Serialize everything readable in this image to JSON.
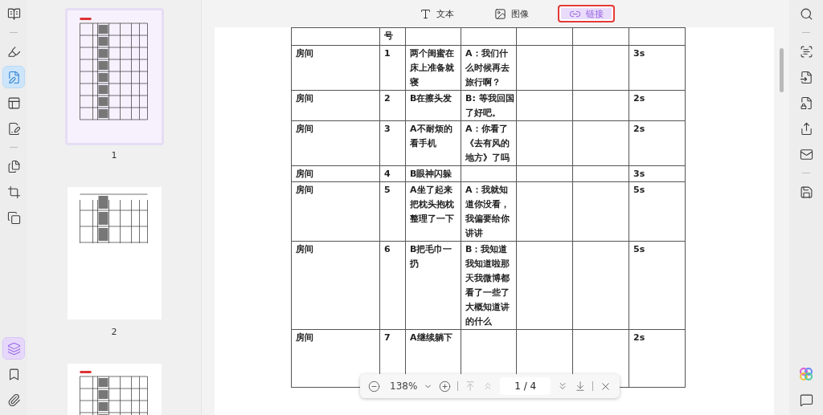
{
  "left_toolbar": {
    "top_tools": [
      {
        "kind": "reader",
        "selected": false
      },
      {
        "kind": "divider"
      },
      {
        "kind": "highlight",
        "selected": false
      },
      {
        "kind": "edit",
        "selected": true
      },
      {
        "kind": "form",
        "selected": false
      },
      {
        "kind": "sign",
        "selected": false
      },
      {
        "kind": "divider"
      },
      {
        "kind": "pages",
        "selected": false
      },
      {
        "kind": "crop",
        "selected": false
      },
      {
        "kind": "copy",
        "selected": false
      }
    ],
    "bottom_tools": [
      {
        "kind": "layers",
        "selected": true
      },
      {
        "kind": "bookmark",
        "selected": false
      },
      {
        "kind": "attachment",
        "selected": false
      }
    ]
  },
  "thumbnails": [
    {
      "label": "1",
      "selected": true
    },
    {
      "label": "2",
      "selected": false
    },
    {
      "selected": false
    }
  ],
  "tabs": [
    {
      "kind": "text",
      "label": "文本",
      "selected": false
    },
    {
      "kind": "image",
      "label": "图像",
      "selected": false
    },
    {
      "kind": "link",
      "label": "链接",
      "selected": true
    }
  ],
  "table": {
    "header_fragment": "号",
    "rows": [
      {
        "scene": "房间",
        "no": "1",
        "action": "两个闺蜜在床上准备就寝",
        "dialogue": "A：我们什么时候再去旅行啊？",
        "duration": "3s"
      },
      {
        "scene": "房间",
        "no": "2",
        "action": "B在擦头发",
        "dialogue": "B: 等我回国了好吧。",
        "duration": "2s"
      },
      {
        "scene": "房间",
        "no": "3",
        "action": "A不耐烦的看手机",
        "dialogue": "A：你看了《去有风的地方》了吗",
        "duration": "2s"
      },
      {
        "scene": "房间",
        "no": "4",
        "action": "B眼神闪躲",
        "duration": "3s"
      },
      {
        "scene": "房间",
        "no": "5",
        "action": "A坐了起来把枕头抱枕整理了一下",
        "dialogue": "A：我就知道你没看，我偏要给你讲讲",
        "duration": "5s"
      },
      {
        "scene": "房间",
        "no": "6",
        "action": "B把毛巾一扔",
        "dialogue": "B：我知道我知道啦那天我微博都看了一些了大概知道讲的什么",
        "duration": "5s"
      },
      {
        "scene": "房间",
        "no": "7",
        "action": "A继续躺下",
        "duration": "2s"
      }
    ]
  },
  "zoom_bar": {
    "zoom": "138%",
    "page": "1 / 4"
  },
  "right_toolbar": {
    "top_tools": [
      {
        "kind": "search"
      },
      {
        "kind": "divider"
      },
      {
        "kind": "ocr"
      },
      {
        "kind": "convert"
      },
      {
        "kind": "protect"
      },
      {
        "kind": "share"
      },
      {
        "kind": "mail"
      },
      {
        "kind": "divider"
      },
      {
        "kind": "save"
      }
    ],
    "bottom_tools": [
      {
        "kind": "ai"
      },
      {
        "kind": "comment"
      }
    ]
  }
}
